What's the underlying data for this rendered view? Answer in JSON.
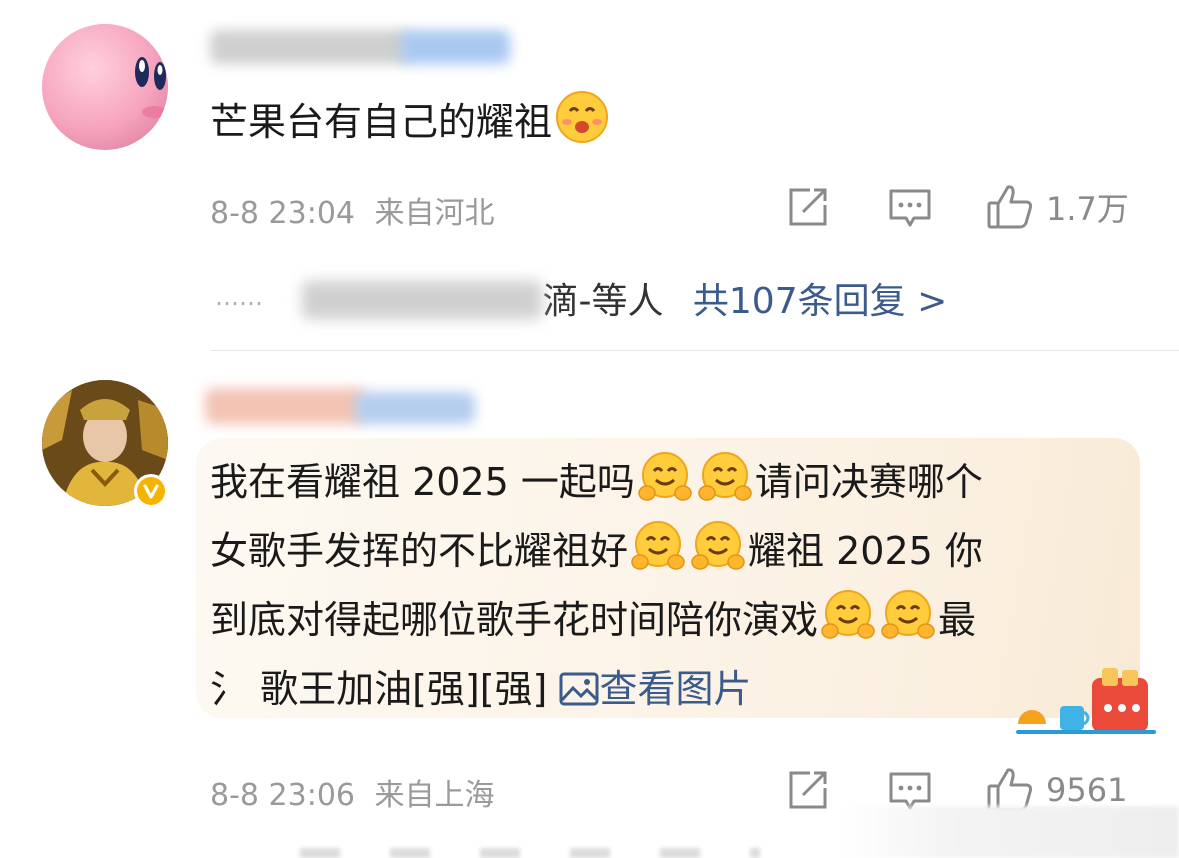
{
  "comments": [
    {
      "avatar": "kirby-avatar",
      "text": "芒果台有自己的耀祖",
      "emoji": "blush-smile-emoji",
      "time": "8-8 23:04",
      "location": "来自河北",
      "likes": "1.7万",
      "reply_preview": "……",
      "reply_names_visible": "滴-等人",
      "reply_link": "共107条回复 >"
    },
    {
      "avatar": "emperor-avatar",
      "verified": true,
      "lines": [
        [
          "我在看耀祖 2025 一起吗",
          "hug-emoji",
          "hug-emoji",
          "请问决赛哪个"
        ],
        [
          "女歌手发挥的不比耀祖好",
          "hug-emoji",
          "hug-emoji",
          "耀祖 2025 你"
        ],
        [
          "到底对得起哪位歌手花时间陪你演戏",
          "hug-emoji",
          "hug-emoji",
          "最"
        ],
        [
          "氵 歌王加油[强][强]"
        ]
      ],
      "view_image": "查看图片",
      "time": "8-8 23:06",
      "location": "来自上海",
      "likes": "9561"
    }
  ],
  "icons": [
    "share-icon",
    "comment-icon",
    "like-icon",
    "image-icon"
  ],
  "colors": {
    "link": "#3a5b8c",
    "meta": "#9a9a9a",
    "verified": "#f5b400"
  }
}
